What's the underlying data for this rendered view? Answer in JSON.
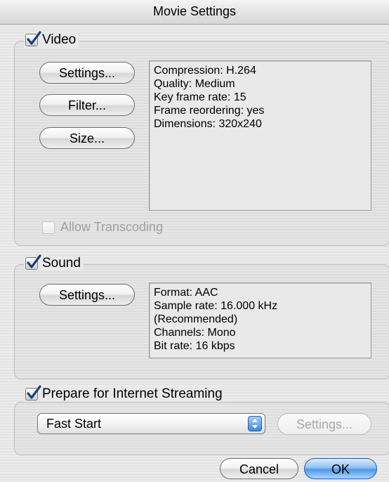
{
  "window": {
    "title": "Movie Settings"
  },
  "video": {
    "label": "Video",
    "checked": true,
    "buttons": {
      "settings": "Settings...",
      "filter": "Filter...",
      "size": "Size..."
    },
    "info": [
      "Compression: H.264",
      "Quality: Medium",
      "Key frame rate: 15",
      "Frame reordering: yes",
      "Dimensions: 320x240"
    ],
    "allow_transcoding": {
      "label": "Allow Transcoding",
      "checked": false,
      "enabled": false
    }
  },
  "sound": {
    "label": "Sound",
    "checked": true,
    "buttons": {
      "settings": "Settings..."
    },
    "info": [
      "Format: AAC",
      "Sample rate: 16.000 kHz",
      "(Recommended)",
      "Channels: Mono",
      "Bit rate: 16 kbps"
    ]
  },
  "streaming": {
    "label": "Prepare for Internet Streaming",
    "checked": true,
    "select_value": "Fast Start",
    "settings_label": "Settings..."
  },
  "footer": {
    "cancel_label": "Cancel",
    "ok_label": "OK"
  },
  "icons": {
    "checkbox_check": "check-icon",
    "popup_arrows": "up-down-arrows-icon"
  },
  "colors": {
    "default_button": "#4d98e6",
    "checkmark": "#1a3f7a"
  }
}
